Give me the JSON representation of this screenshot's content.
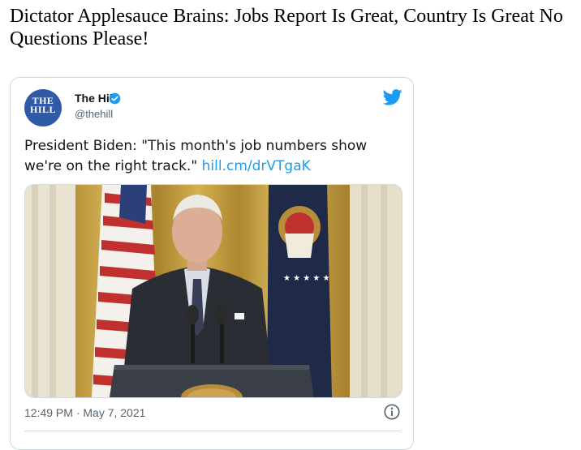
{
  "article": {
    "headline": "Dictator Applesauce Brains: Jobs Report Is Great, Country Is Great No Questions Please!"
  },
  "tweet": {
    "author_name": "The Hill",
    "author_handle": "@thehill",
    "avatar_logo_text": "THE HILL",
    "verified": true,
    "text": "President Biden: \"This month's job numbers show we're on the right track.\" ",
    "link_text": "hill.cm/drVTgaK",
    "timestamp": "12:49 PM · May 7, 2021",
    "media_icons": {
      "platform": "twitter-bird-icon",
      "info": "info-icon"
    }
  },
  "colors": {
    "twitter_blue": "#1d9bf0",
    "border": "#cfd9de",
    "muted_text": "#536471",
    "avatar_blue": "#2e5aa8",
    "curtain_gold": "#c9a43a",
    "suit_dark": "#2a2d33"
  }
}
